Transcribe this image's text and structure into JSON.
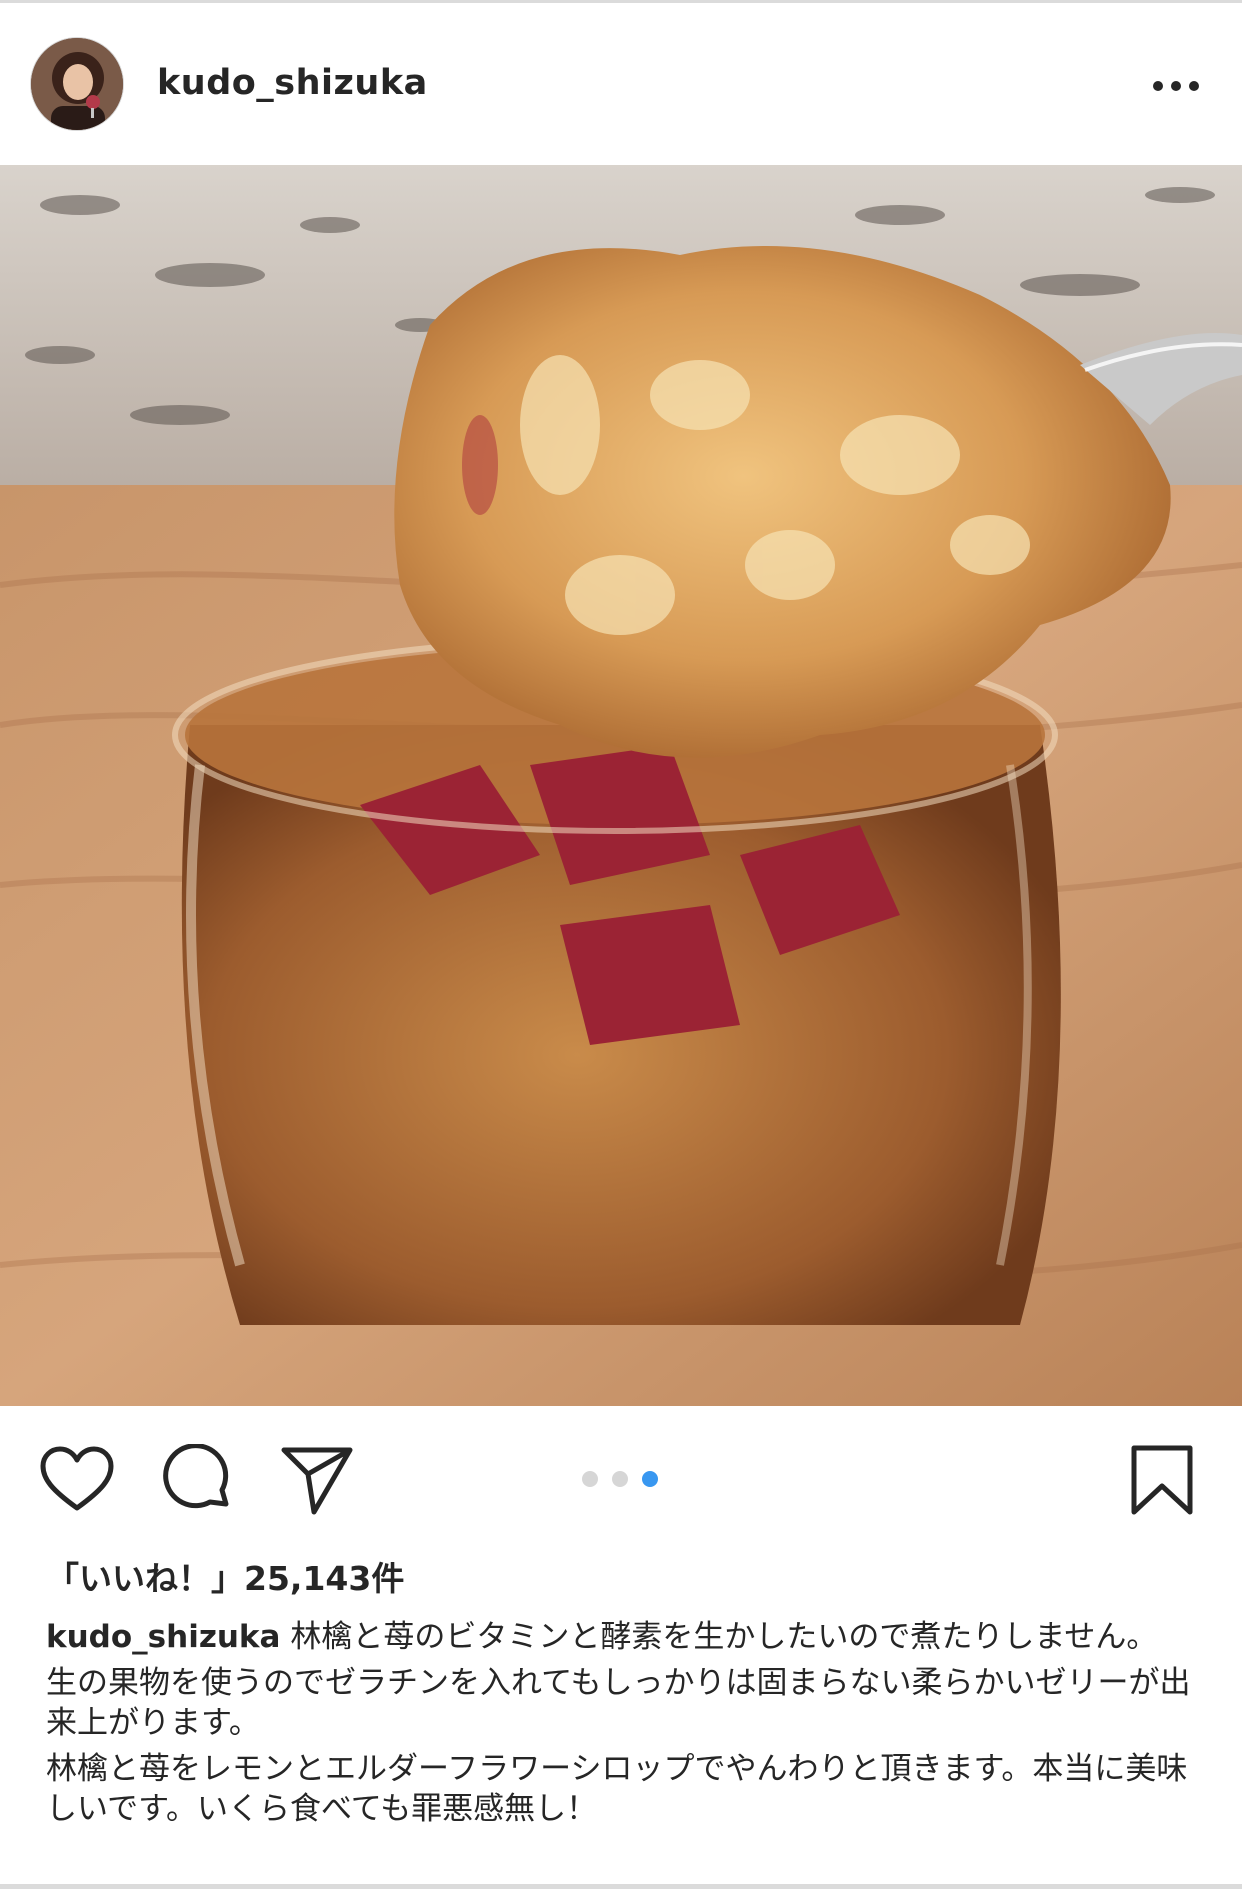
{
  "post": {
    "username": "kudo_shizuka",
    "avatar_icon": "profile-photo",
    "more_icon": "more-options-icon"
  },
  "media": {
    "description_icon": "photo-apple-strawberry-jelly",
    "carousel": {
      "total": 3,
      "active_index": 3
    }
  },
  "actions": {
    "like_icon": "heart-icon",
    "comment_icon": "comment-bubble-icon",
    "share_icon": "paper-plane-icon",
    "save_icon": "bookmark-icon"
  },
  "likes": {
    "text": "「いいね！」25,143件"
  },
  "caption": {
    "username": "kudo_shizuka",
    "line1": "林檎と苺のビタミンと酵素を生かしたいので煮たりしません。",
    "line2": "生の果物を使うのでゼラチンを入れてもしっかりは固まらない柔らかいゼリーが出来上がります。",
    "line3": "林檎と苺をレモンとエルダーフラワーシロップでやんわりと頂きます。本当に美味しいです。いくら食べても罪悪感無し！"
  },
  "colors": {
    "accent": "#3897f0",
    "text": "#262626",
    "divider": "#dbdbdb"
  }
}
